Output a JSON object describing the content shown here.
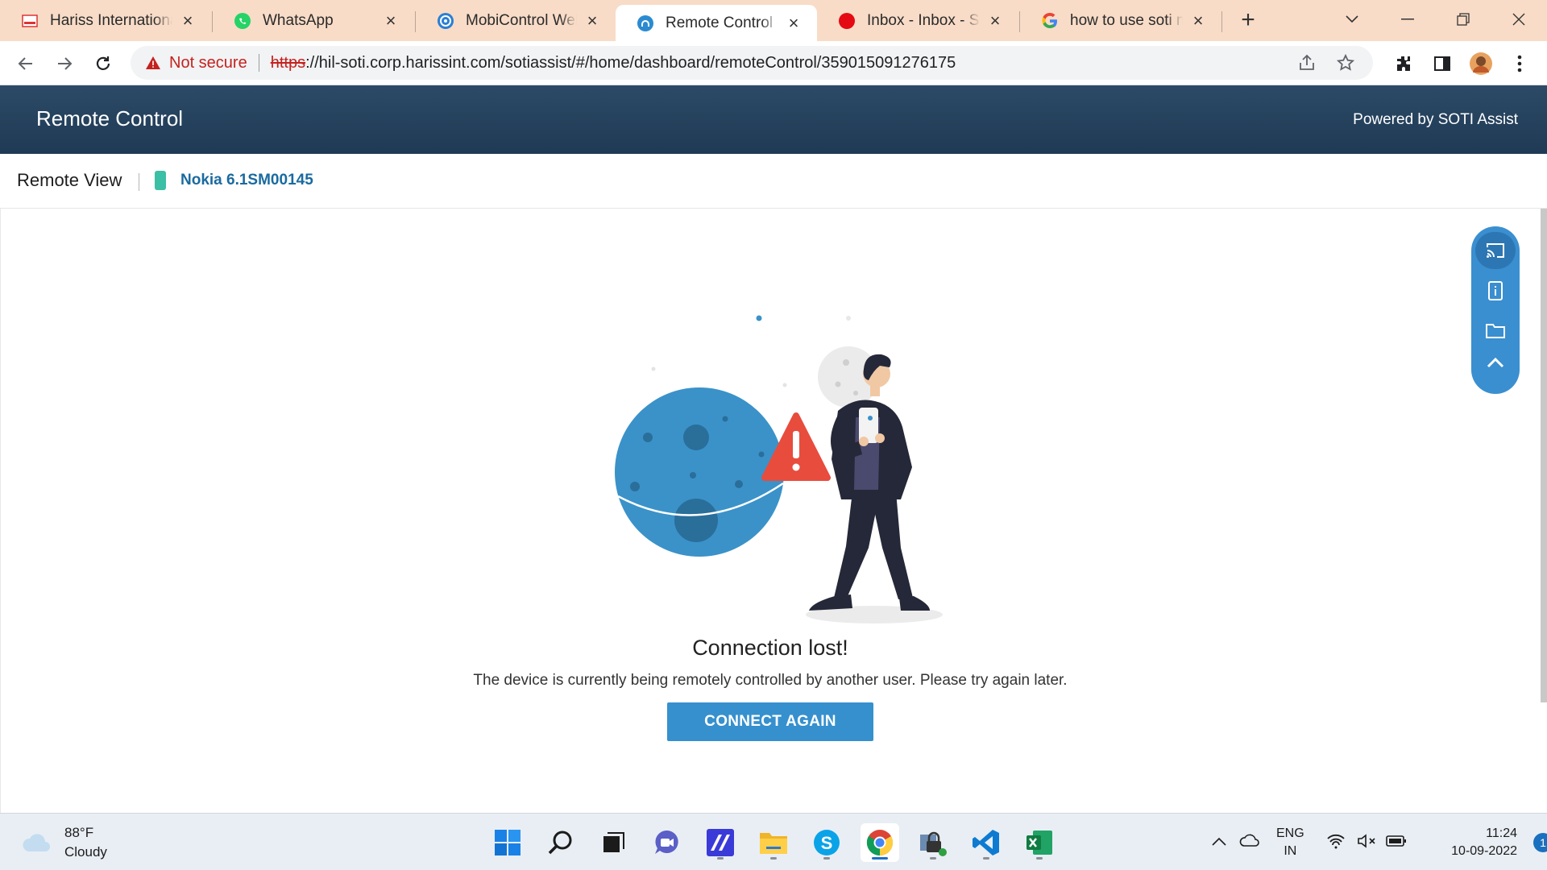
{
  "browser": {
    "tabs": [
      {
        "title": "Hariss International",
        "favicon": "hariss-logo-icon"
      },
      {
        "title": "WhatsApp",
        "favicon": "whatsapp-icon"
      },
      {
        "title": "MobiControl WebConsole",
        "favicon": "mobicontrol-icon"
      },
      {
        "title": "Remote Control - Nokia",
        "favicon": "soti-assist-icon",
        "active": true
      },
      {
        "title": "Inbox - Inbox - Service",
        "favicon": "red-circle-icon"
      },
      {
        "title": "how to use soti mobicontrol",
        "favicon": "google-icon"
      }
    ],
    "new_tab": "+",
    "url": {
      "security_label": "Not secure",
      "protocol": "https",
      "rest": "://hil-soti.corp.harissint.com/sotiassist/#/home/dashboard/remoteControl/359015091276175"
    }
  },
  "app": {
    "title": "Remote Control",
    "powered_by": "Powered by SOTI Assist",
    "view_label": "Remote View",
    "device_name": "Nokia 6.1SM00145"
  },
  "status": {
    "title": "Connection lost!",
    "message": "The device is currently being remotely controlled by another user. Please try again later.",
    "button_label": "CONNECT AGAIN"
  },
  "side_tools": [
    "cast-screen-icon",
    "device-info-icon",
    "folder-icon",
    "collapse-up-icon"
  ],
  "taskbar": {
    "weather": {
      "temp": "88°F",
      "condition": "Cloudy"
    },
    "apps": [
      "windows-start-icon",
      "search-icon",
      "task-view-icon",
      "teams-chat-icon",
      "zoomit-icon",
      "file-explorer-icon",
      "skype-icon",
      "chrome-icon",
      "vpn-lock-icon",
      "vscode-icon",
      "excel-icon"
    ],
    "lang_line1": "ENG",
    "lang_line2": "IN",
    "time": "11:24",
    "date": "10-09-2022",
    "notifications": "1"
  },
  "colors": {
    "header_bg": "#1f3a55",
    "accent": "#3690ce",
    "warning": "#e84c3d",
    "planet": "#3a92c9"
  }
}
